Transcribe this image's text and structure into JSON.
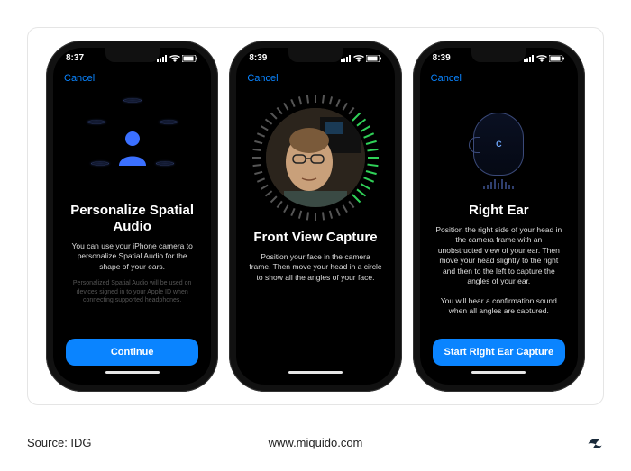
{
  "footer": {
    "source_label": "Source: IDG",
    "site": "www.miquido.com"
  },
  "phones": [
    {
      "time": "8:37",
      "cancel": "Cancel",
      "title": "Personalize Spatial Audio",
      "desc": "You can use your iPhone camera to personalize Spatial Audio for the shape of your ears.",
      "fineprint": "Personalized Spatial Audio will be used on devices signed in to your Apple ID when connecting supported headphones.",
      "cta": "Continue"
    },
    {
      "time": "8:39",
      "cancel": "Cancel",
      "title": "Front View Capture",
      "desc": "Position your face in the camera frame. Then move your head in a circle to show all the angles of your face."
    },
    {
      "time": "8:39",
      "cancel": "Cancel",
      "title": "Right Ear",
      "desc": "Position the right side of your head in the camera frame with an unobstructed view of your ear. Then move your head slightly to the right and then to the left to capture the angles of your ear.",
      "desc2": "You will hear a confirmation sound when all angles are captured.",
      "cta": "Start Right Ear Capture",
      "ear_label": "C"
    }
  ]
}
